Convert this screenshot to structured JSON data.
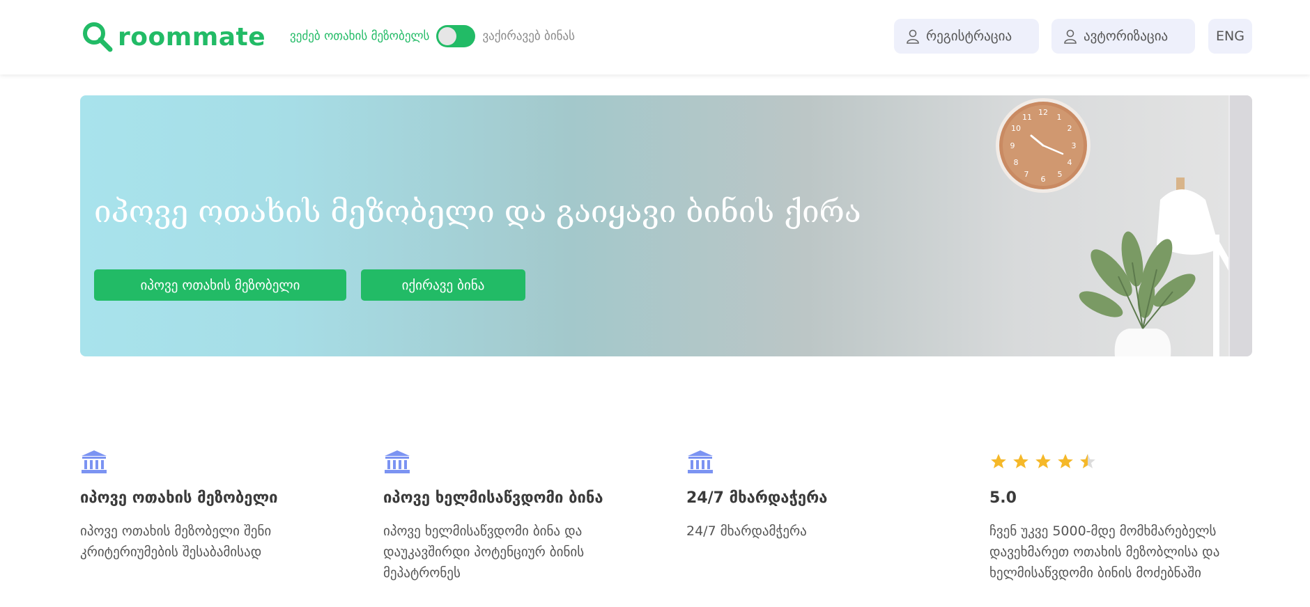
{
  "header": {
    "logo_text": "roommate",
    "mode_left": "ვეძებ ოთახის მეზობელს",
    "mode_right": "ვაქირავებ ბინას",
    "register_label": "რეგისტრაცია",
    "login_label": "ავტორიზაცია",
    "language_label": "ENG"
  },
  "hero": {
    "title": "იპოვე ოთახის მეზობელი და გაიყავი ბინის ქირა",
    "button_find_roommate": "იპოვე ოთახის მეზობელი",
    "button_rent": "იქირავე ბინა"
  },
  "features": [
    {
      "icon": "bank-icon",
      "title": "იპოვე ოთახის მეზობელი",
      "description": "იპოვე ოთახის მეზობელი შენი კრიტერიუმების შესაბამისად"
    },
    {
      "icon": "bank-icon",
      "title": "იპოვე ხელმისაწვდომი ბინა",
      "description": "იპოვე ხელმისაწვდომი ბინა და დაუკავშირდი პოტენციურ ბინის მეპატრონეს"
    },
    {
      "icon": "bank-icon",
      "title": "24/7 მხარდაჭერა",
      "description": "24/7 მხარდამჭერა"
    },
    {
      "icon": "star-rating",
      "rating": 4.5,
      "title": "5.0",
      "description": "ჩვენ უკვე 5000-მდე მომხმარებელს დავეხმარეთ ოთახის მეზობლისა და ხელმისაწვდომი ბინის მოძებნაში"
    }
  ],
  "colors": {
    "brand_green": "#22bb66",
    "icon_blue": "#7b93f2",
    "star_yellow": "#f5b829",
    "button_bg": "#eef0fb"
  }
}
